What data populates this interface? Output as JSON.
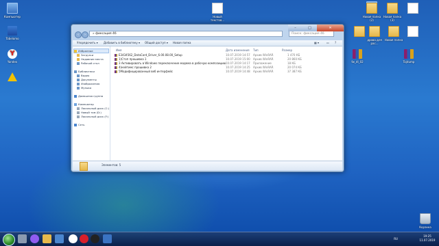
{
  "desktop": {
    "left_icons": [
      {
        "label": "Компьютер",
        "icon": "computer-icon"
      },
      {
        "label": "Tobelomo",
        "icon": "flash-drive-icon"
      },
      {
        "label": "Yandex",
        "icon": "yandex-icon"
      },
      {
        "label": "",
        "icon": "warning-icon"
      }
    ],
    "top_icons": [
      {
        "label": "Новый текстов...",
        "icon": "text-document-icon"
      }
    ],
    "right_icons": [
      {
        "label": "",
        "icon": "computer-icon"
      },
      {
        "label": "Новая папка (2)",
        "icon": "folder-icon"
      },
      {
        "label": "Новая папка (3)",
        "icon": "folder-icon"
      },
      {
        "label": "",
        "icon": "text-document-icon"
      },
      {
        "label": "",
        "icon": "folder-icon"
      },
      {
        "label": "дрова для рас...",
        "icon": "folder-icon"
      },
      {
        "label": "Новая папка",
        "icon": "folder-icon"
      },
      {
        "label": "",
        "icon": "text-document-icon"
      },
      {
        "label": "fw_dl_02",
        "icon": "rar-archive-icon"
      },
      {
        "label": "Tojdump",
        "icon": "rar-archive-icon"
      },
      {
        "label": "Корзина",
        "icon": "recycle-bin-icon"
      }
    ]
  },
  "explorer": {
    "address": "» фиксация 4б",
    "search_placeholder": "Поиск: фиксация 4б",
    "toolbar": [
      "Упорядочить ▾",
      "Добавить в библиотеку ▾",
      "Общий доступ ▾",
      "Новая папка"
    ],
    "sidebar": {
      "favorites": {
        "label": "Избранное",
        "items": [
          "Загрузки",
          "Недавние места",
          "Рабочий стол"
        ]
      },
      "libraries": {
        "label": "Библиотеки",
        "items": [
          "Видео",
          "Документы",
          "Изображения",
          "Музыка"
        ]
      },
      "homegroup": "Домашняя группа",
      "computer": {
        "label": "Компьютер",
        "items": [
          "Локальный диск (C:)",
          "Новый том (D:)",
          "Локальный диск (F:)"
        ]
      },
      "network": "Сеть"
    },
    "columns": [
      "Имя",
      "Дата изменения",
      "Тип",
      "Размер"
    ],
    "files": [
      {
        "name": "E3434562_DataCard_Driver_6.00.08.00_Setup",
        "date": "10.07.2019 14:57",
        "type": "Архив WinRAR",
        "size": "1 470 КБ"
      },
      {
        "name": "1)Стоп прошивка 1",
        "date": "10.07.2019 15:00",
        "type": "Архив WinRAR",
        "size": "20 860 КБ"
      },
      {
        "name": "3 Активировать в Windows переключение модема в рабочую композицию",
        "date": "10.07.2019 14:17",
        "type": "Приложение",
        "size": "18 КБ"
      },
      {
        "name": "4)кейтимс прошивка 2",
        "date": "10.07.2019 14:25",
        "type": "Архив WinRAR",
        "size": "20 074 КБ"
      },
      {
        "name": "5Модифицированный веб интерфейс",
        "date": "10.07.2019 14:48",
        "type": "Архив WinRAR",
        "size": "37 387 КБ"
      }
    ],
    "status": "Элементов: 5"
  },
  "taskbar": {
    "lang": "RU",
    "time": "19:25",
    "date": "11.07.2019"
  }
}
